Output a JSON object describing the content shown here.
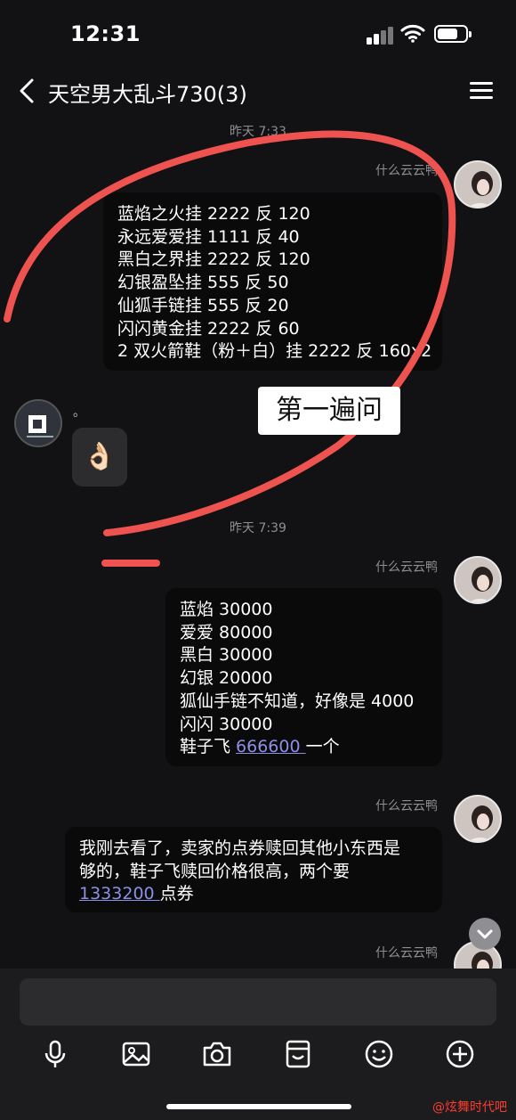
{
  "status_bar": {
    "time": "12:31"
  },
  "header": {
    "title": "天空男大乱斗730(3)"
  },
  "messages": {
    "ts1": "昨天 7:33",
    "m1": {
      "sender": "什么云云鸭",
      "lines": [
        "蓝焰之火挂 2222 反 120",
        "永远爱爱挂 1111 反 40",
        "黑白之界挂 2222 反 120",
        "幻银盈坠挂 555 反 50",
        "仙狐手链挂 555 反 20",
        "闪闪黄金挂 2222 反 60",
        "2 双火箭鞋（粉＋白）挂 2222 反 160x2"
      ]
    },
    "m2": {
      "dot": "。",
      "emoji": "👌🏻"
    },
    "ts2": "昨天 7:39",
    "m3": {
      "sender": "什么云云鸭",
      "lines": [
        "蓝焰 30000",
        "爱爱 80000",
        "黑白 30000",
        "幻银 20000",
        "狐仙手链不知道，好像是 4000",
        "闪闪 30000"
      ],
      "last_prefix": "鞋子飞 ",
      "last_link": "666600 ",
      "last_suffix": "一个"
    },
    "m4": {
      "sender": "什么云云鸭",
      "line1": "我刚去看了，卖家的点券赎回其他小东西是",
      "line2": "够的，鞋子飞赎回价格很高，两个要",
      "link": "1333200 ",
      "suffix": "点券"
    },
    "m5": {
      "sender": "什么云云鸭"
    }
  },
  "annotation": {
    "text": "第一遍问"
  },
  "watermark": "@炫舞时代吧",
  "colors": {
    "annotation_stroke": "#ef5350",
    "link": "#8d8fe6"
  },
  "icons": [
    "back-icon",
    "menu-icon",
    "microphone-icon",
    "image-icon",
    "camera-icon",
    "sticker-icon",
    "emoji-icon",
    "plus-icon",
    "chevron-down-icon"
  ]
}
